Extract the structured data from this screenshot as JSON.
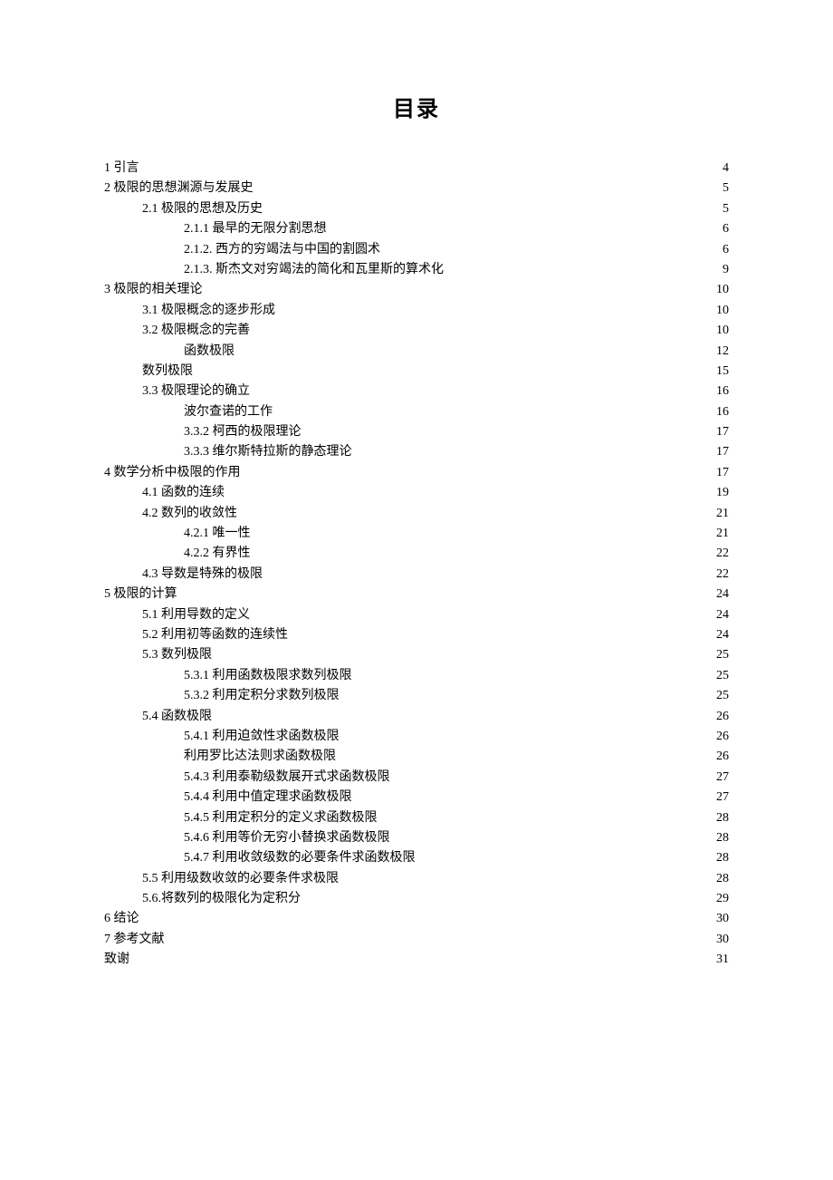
{
  "title": "目录",
  "toc": [
    {
      "indent": 0,
      "label": "1 引言",
      "page": "4"
    },
    {
      "indent": 0,
      "label": "2 极限的思想渊源与发展史",
      "page": "5"
    },
    {
      "indent": 1,
      "label": "2.1 极限的思想及历史",
      "page": "5"
    },
    {
      "indent": 2,
      "label": "2.1.1 最早的无限分割思想",
      "page": "6"
    },
    {
      "indent": 2,
      "label": "2.1.2. 西方的穷竭法与中国的割圆术",
      "page": "6"
    },
    {
      "indent": 2,
      "label": "2.1.3. 斯杰文对穷竭法的简化和瓦里斯的算术化",
      "page": "9"
    },
    {
      "indent": 0,
      "label": "3 极限的相关理论",
      "page": "10"
    },
    {
      "indent": 1,
      "label": "3.1 极限概念的逐步形成",
      "page": "10"
    },
    {
      "indent": 1,
      "label": "3.2 极限概念的完善",
      "page": "10"
    },
    {
      "indent": 2,
      "label": "函数极限",
      "page": "12"
    },
    {
      "indent": 1,
      "label": "数列极限",
      "page": "15"
    },
    {
      "indent": 1,
      "label": "3.3 极限理论的确立",
      "page": "16"
    },
    {
      "indent": 2,
      "label": "波尔查诺的工作",
      "page": "16"
    },
    {
      "indent": 2,
      "label": "3.3.2 柯西的极限理论",
      "page": "17"
    },
    {
      "indent": 2,
      "label": "3.3.3 维尔斯特拉斯的静态理论",
      "page": "17"
    },
    {
      "indent": 0,
      "label": "4 数学分析中极限的作用",
      "page": "17"
    },
    {
      "indent": 1,
      "label": "4.1 函数的连续",
      "page": "19"
    },
    {
      "indent": 1,
      "label": "4.2 数列的收敛性",
      "page": "21"
    },
    {
      "indent": 2,
      "label": "4.2.1 唯一性",
      "page": "21"
    },
    {
      "indent": 2,
      "label": "4.2.2  有界性",
      "page": "22"
    },
    {
      "indent": 1,
      "label": "4.3 导数是特殊的极限",
      "page": "22"
    },
    {
      "indent": 0,
      "label": "5 极限的计算",
      "page": "24"
    },
    {
      "indent": 1,
      "label": "5.1 利用导数的定义",
      "page": "24"
    },
    {
      "indent": 1,
      "label": "5.2 利用初等函数的连续性",
      "page": "24"
    },
    {
      "indent": 1,
      "label": "5.3 数列极限",
      "page": "25"
    },
    {
      "indent": 2,
      "label": "5.3.1 利用函数极限求数列极限",
      "page": "25"
    },
    {
      "indent": 2,
      "label": "5.3.2 利用定积分求数列极限",
      "page": "25"
    },
    {
      "indent": 1,
      "label": "5.4 函数极限",
      "page": "26"
    },
    {
      "indent": 2,
      "label": "5.4.1 利用迫敛性求函数极限",
      "page": "26"
    },
    {
      "indent": 2,
      "label": "利用罗比达法则求函数极限",
      "page": "26"
    },
    {
      "indent": 2,
      "label": "5.4.3 利用泰勒级数展开式求函数极限",
      "page": "27"
    },
    {
      "indent": 2,
      "label": "5.4.4 利用中值定理求函数极限",
      "page": "27"
    },
    {
      "indent": 2,
      "label": "5.4.5 利用定积分的定义求函数极限",
      "page": "28"
    },
    {
      "indent": 2,
      "label": "5.4.6 利用等价无穷小替换求函数极限",
      "page": "28"
    },
    {
      "indent": 2,
      "label": "5.4.7 利用收敛级数的必要条件求函数极限",
      "page": "28"
    },
    {
      "indent": 1,
      "label": "5.5 利用级数收敛的必要条件求极限",
      "page": "28"
    },
    {
      "indent": 1,
      "label": "5.6.将数列的极限化为定积分",
      "page": "29"
    },
    {
      "indent": 0,
      "label": "6 结论",
      "page": "30"
    },
    {
      "indent": 0,
      "label": "7 参考文献",
      "page": "30"
    },
    {
      "indent": 0,
      "label": "致谢",
      "page": "31"
    }
  ]
}
